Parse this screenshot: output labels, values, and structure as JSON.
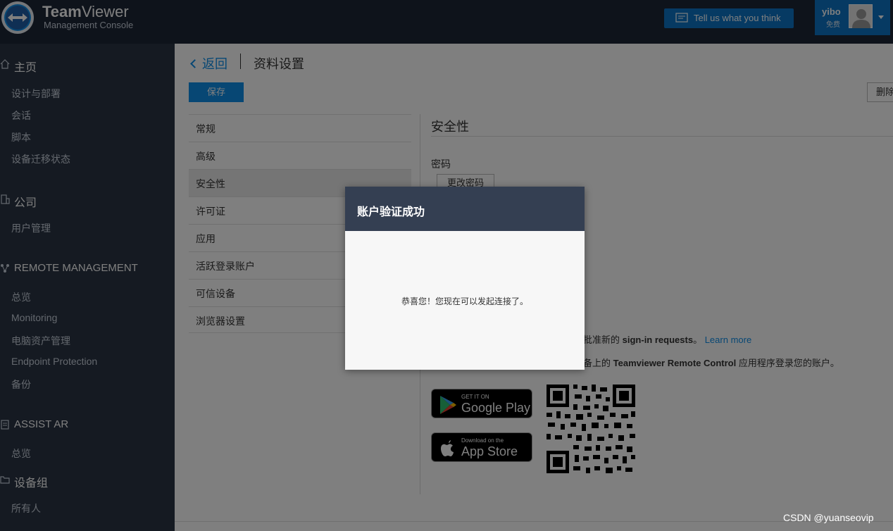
{
  "header": {
    "brand_name_bold": "Team",
    "brand_name_rest": "Viewer",
    "brand_sub": "Management Console",
    "feedback_label": "Tell us what you think",
    "user_name": "yibo",
    "user_tier": "免费"
  },
  "sidebar": {
    "home": "主页",
    "home_items": [
      "设计与部署",
      "会话",
      "脚本",
      "设备迁移状态"
    ],
    "company": "公司",
    "company_items": [
      "用户管理"
    ],
    "remote": "REMOTE MANAGEMENT",
    "remote_items": [
      "总览",
      "Monitoring",
      "电脑资产管理",
      "Endpoint Protection",
      "备份"
    ],
    "assist": "ASSIST AR",
    "assist_items": [
      "总览"
    ],
    "groups": "设备组",
    "groups_items": [
      "所有人"
    ]
  },
  "main": {
    "back_label": "返回",
    "page_title": "资料设置",
    "save_label": "保存",
    "delete_label": "删除",
    "settings_items": [
      "常规",
      "高级",
      "安全性",
      "许可证",
      "应用",
      "活跃登录账户",
      "可信设备",
      "浏览器设置"
    ],
    "section_title": "安全性",
    "password_label": "密码",
    "change_password_label": "更改密码",
    "signin_prefix": "批准新的",
    "signin_bold": "sign-in requests",
    "signin_suffix": "。",
    "learn_more": "Learn more",
    "app_prefix": "备上的",
    "app_bold": "Teamviewer Remote Control",
    "app_suffix": "应用程序登录您的账户。",
    "google_small": "GET IT ON",
    "google_big": "Google Play",
    "apple_small": "Download on the",
    "apple_big": "App Store"
  },
  "modal": {
    "title": "账户验证成功",
    "message": "恭喜您！您现在可以发起连接了。"
  },
  "watermark": "CSDN @yuanseovip",
  "colors": {
    "header_bg": "#1c2637",
    "sidebar_bg": "#2a3545",
    "accent": "#0e8ee9",
    "modal_header": "#343f52"
  }
}
